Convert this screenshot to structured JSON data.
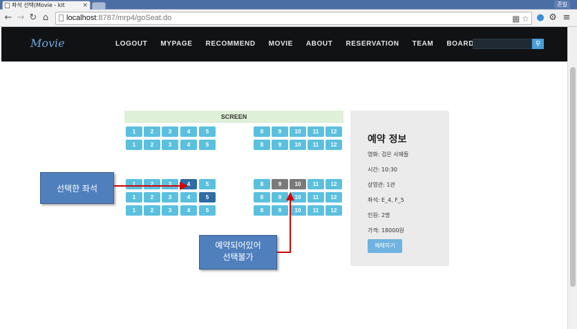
{
  "browser": {
    "tab_title": "좌석 선택(Movie - kit",
    "tab_close": "×",
    "user_button": "준일",
    "url_host": "localhost",
    "url_rest": ":8787/mrp4/goSeat.do",
    "icons": [
      "back-icon",
      "forward-icon",
      "reload-icon",
      "home-icon",
      "translate-icon",
      "star-icon",
      "extension-icon",
      "gear-icon",
      "menu-icon"
    ]
  },
  "site": {
    "logo": "Movie",
    "menu": [
      "LOGOUT",
      "MYPAGE",
      "RECOMMEND",
      "MOVIE",
      "ABOUT",
      "RESERVATION",
      "TEAM",
      "BOARD"
    ],
    "search_icon": "search-icon"
  },
  "seats": {
    "screen_label": "SCREEN",
    "left_numbers": [
      "1",
      "2",
      "3",
      "4",
      "5"
    ],
    "right_numbers": [
      "8",
      "9",
      "10",
      "11",
      "12"
    ],
    "rows": [
      {
        "group": "top",
        "selected": [],
        "reserved": []
      },
      {
        "group": "top",
        "selected": [],
        "reserved": []
      },
      {
        "group": "bottom",
        "selected": [
          "4"
        ],
        "reserved": [
          "9",
          "10"
        ]
      },
      {
        "group": "bottom",
        "selected": [
          "5"
        ],
        "reserved": []
      },
      {
        "group": "bottom",
        "selected": [],
        "reserved": []
      }
    ],
    "colors": {
      "available": "#5bc0de",
      "selected": "#2e6da4",
      "reserved": "#7a7a7a"
    }
  },
  "info": {
    "title": "예약 정보",
    "movie": "영화: 검은 사제들",
    "time": "시간: 10:30",
    "hall": "상영관: 1관",
    "seats": "좌석: E_4, F_5",
    "people": "인원: 2명",
    "price": "가격: 18000원",
    "book_button": "예매하기"
  },
  "annotations": {
    "selected_label": "선택한 좌석",
    "reserved_line1": "예약되어있어",
    "reserved_line2": "선택불가",
    "arrow_color": "#d40000"
  }
}
